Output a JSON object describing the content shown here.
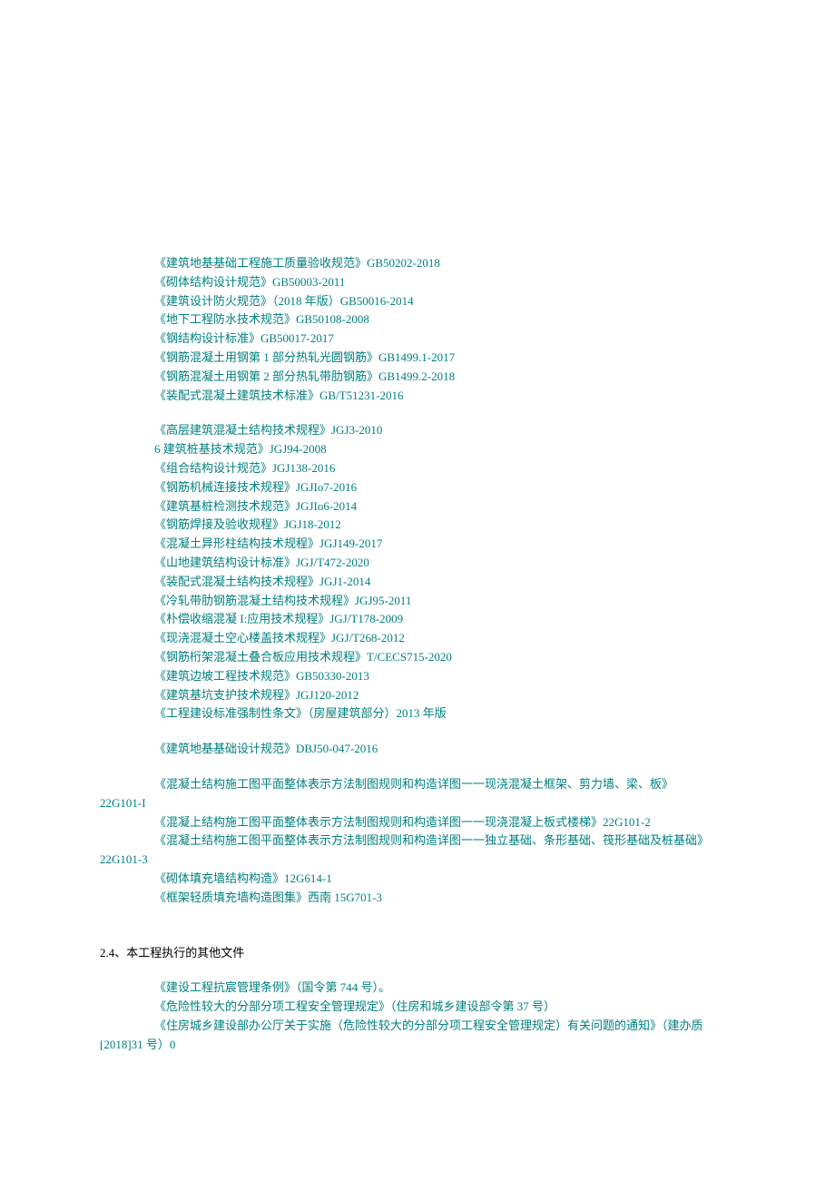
{
  "group1": [
    "《建筑地基基础工程施工质量验收规范》GB50202-2018",
    "《砌体结构设计规范》GB50003-2011",
    "《建筑设计防火规范》（2018 年版）GB50016-2014",
    "《地下工程防水技术规范》GB50108-2008",
    "《钢结构设计标准》GB50017-2017",
    "《钢筋混凝土用钢第 1 部分热轧光圆钢筋》GB1499.1-2017",
    "《钢筋混凝土用钢第 2 部分热轧带肋钢筋》GB1499.2-2018",
    "《装配式混凝土建筑技术标准》GB/T51231-2016"
  ],
  "group2": [
    "《高层建筑混凝土结构技术规程》JGJ3-2010",
    "6 建筑桩基技术规范》JGJ94-2008",
    "《组合结构设计规范》JGJ138-2016",
    "《钢筋机械连接技术规程》JGJIo7-2016",
    "《建筑基桩检测技术规范》JGJIo6-2014",
    "《钢筋焊接及验收规程》JGJ18-2012",
    "《混凝土异形柱结构技术规程》JGJ149-2017",
    "《山地建筑结构设计标准》JGJ/T472-2020",
    "《装配式混凝土结构技术规程》JGJ1-2014",
    "《冷轧带肋钢筋混凝土结构技术规程》JGJ95-2011",
    "《朴偿收缩混凝 I:应用技术规程》JGJ/T178-2009",
    "《现浇混凝土空心楼盖技术规程》JGJ/T268-2012",
    "《钢筋桁架混凝土叠合板应用技术规程》T/CECS715-2020",
    "《建筑边坡工程技术规范》GB50330-2013",
    "《建筑基坑支护技术规程》JGJ120-2012",
    "《工程建设标准强制性条文》（房屋建筑部分）2013 年版"
  ],
  "group3": [
    "《建筑地基基础设计规范》DBJ50-047-2016"
  ],
  "group4_wrap1_a": "《混凝土结构施工图平面整体表示方法制图规则和构造详图一一现浇混凝土框架、剪力墙、梁、板》",
  "group4_wrap1_b": "22G101-I",
  "group4_line2": "《混凝上结构施工图平面整体表示方法制图规则和构造详图一一现浇混凝上板式楼梯》22G101-2",
  "group4_wrap2_a": "《混凝土结构施工图平面整体表示方法制图规则和构造详图一一独立基础、条形基础、筏形基础及桩基础》",
  "group4_wrap2_b": "22G101-3",
  "group4_line4": "《砌体填充墙结构构造》12G614-1",
  "group4_line5": "《框架轻质填充墙构造图集》西南 15G701-3",
  "section_heading": "2.4、本工程执行的其他文件",
  "other_doc1": "《建设工程抗宸管理条例》（国令第 744 号）。",
  "other_doc2": "《危险性较大的分部分项工程安全管理规定》（住房和城乡建设部令第 37 号）",
  "other_doc3_a": "《住房城乡建设部办公厅关于实施（危险性较大的分部分项工程安全管理规定）有关问题的通知》（建办质",
  "other_doc3_b": "[2018]31 号）0"
}
